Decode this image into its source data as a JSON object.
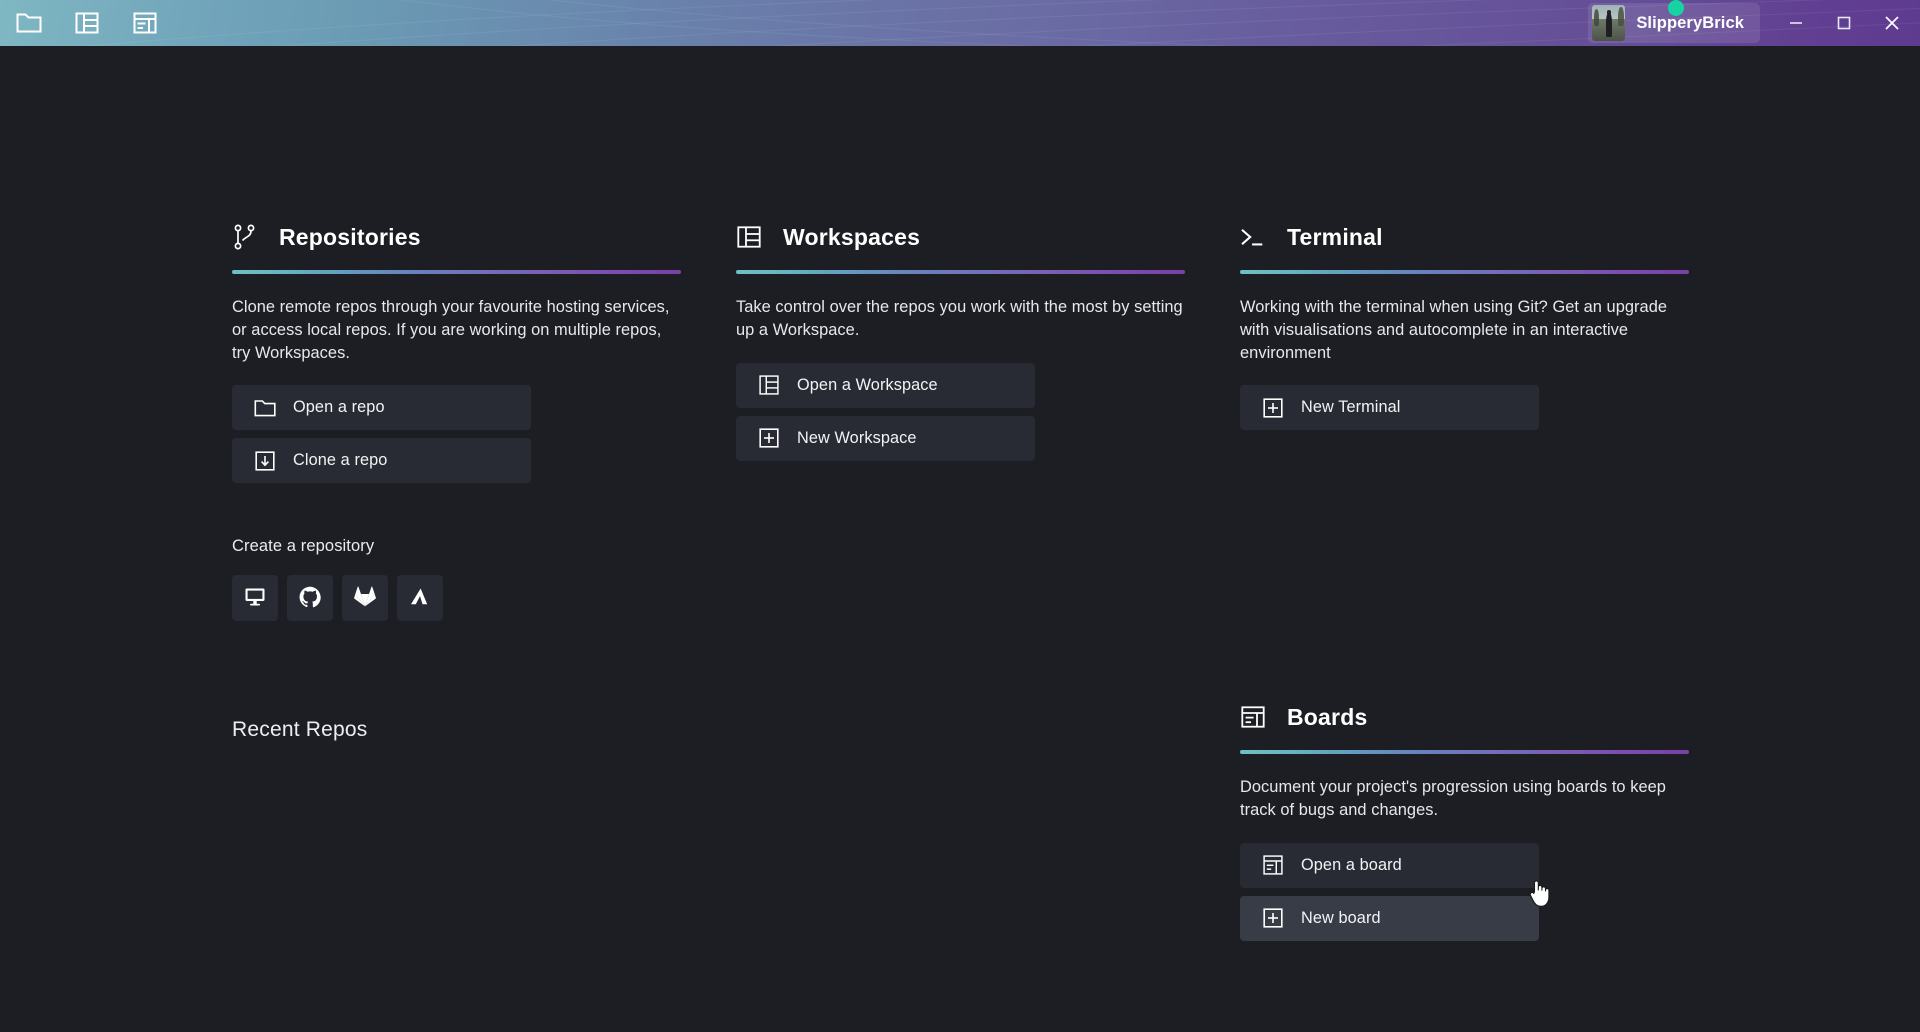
{
  "titlebar": {
    "left_icons": [
      {
        "name": "folder-icon",
        "label": "Open folder"
      },
      {
        "name": "workspace-panel-icon",
        "label": "Workspaces"
      },
      {
        "name": "board-icon",
        "label": "Boards"
      }
    ],
    "user": {
      "name": "SlipperyBrick",
      "status": "online",
      "status_color": "#16d3a4"
    },
    "window_controls": {
      "minimize": "minimize",
      "maximize": "maximize",
      "close": "close"
    },
    "gradient_from": "#7fb7c2",
    "gradient_to": "#5e3b90"
  },
  "theme": {
    "background": "#1c1e24",
    "button_background": "#282b33",
    "button_hover_background": "#383c47",
    "accent_gradient_from": "#6cc2c2",
    "accent_gradient_to": "#7b3fa8",
    "text_primary": "#ffffff",
    "text_secondary": "#e6e8ec"
  },
  "sections": {
    "repositories": {
      "title": "Repositories",
      "icon": "git-branch-icon",
      "description": "Clone remote repos through your favourite hosting services, or access local repos. If you are working on multiple repos, try Workspaces.",
      "buttons": [
        {
          "label": "Open a repo",
          "icon": "folder-icon"
        },
        {
          "label": "Clone a repo",
          "icon": "download-box-icon"
        }
      ]
    },
    "create_repository": {
      "title": "Create a repository",
      "hosts": [
        {
          "name": "local-desktop-icon",
          "label": "Local"
        },
        {
          "name": "github-icon",
          "label": "GitHub"
        },
        {
          "name": "gitlab-icon",
          "label": "GitLab"
        },
        {
          "name": "azure-devops-icon",
          "label": "Azure DevOps"
        }
      ]
    },
    "recent_repos": {
      "title": "Recent Repos",
      "items": []
    },
    "workspaces": {
      "title": "Workspaces",
      "icon": "workspace-panel-icon",
      "description": "Take control over the repos you work with the most by setting up a Workspace.",
      "buttons": [
        {
          "label": "Open a Workspace",
          "icon": "workspace-panel-icon"
        },
        {
          "label": "New Workspace",
          "icon": "plus-box-icon"
        }
      ]
    },
    "terminal": {
      "title": "Terminal",
      "icon": "terminal-prompt-icon",
      "description": "Working with the terminal when using Git? Get an upgrade with visualisations and autocomplete in an interactive environment",
      "buttons": [
        {
          "label": "New Terminal",
          "icon": "plus-box-icon"
        }
      ]
    },
    "boards": {
      "title": "Boards",
      "icon": "board-icon",
      "description": "Document your project's progression using boards to keep track of bugs and changes.",
      "buttons": [
        {
          "label": "Open a board",
          "icon": "board-icon"
        },
        {
          "label": "New board",
          "icon": "plus-box-icon",
          "hovered": true
        }
      ]
    }
  }
}
